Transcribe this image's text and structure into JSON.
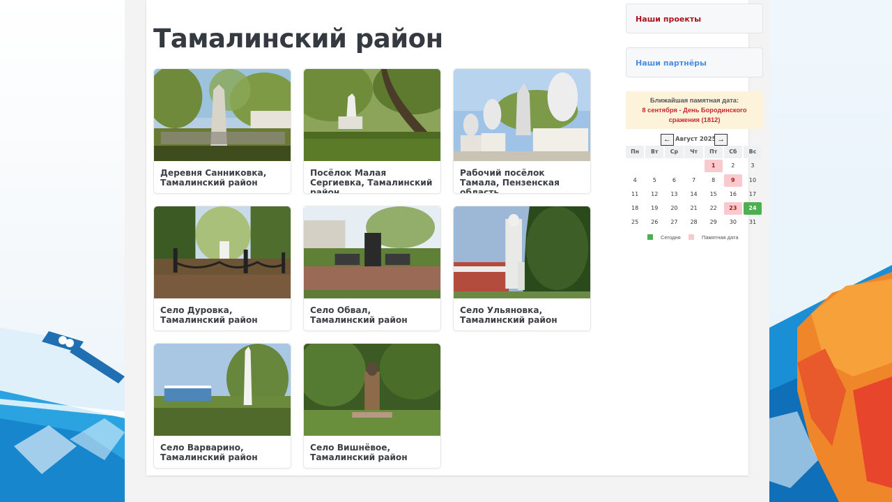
{
  "page": {
    "title": "Тамалинский район"
  },
  "items": [
    {
      "caption": "Деревня Санниковка, Тамалинский район",
      "photo": "monument-obelisk-photo"
    },
    {
      "caption": "Посёлок Малая Сергиевка, Тамалинский район,",
      "photo": "monument-park-photo"
    },
    {
      "caption": "Рабочий посёлок Тамала, Пензенская область",
      "photo": "monument-busts-photo"
    },
    {
      "caption": "Село Дуровка, Тамалинский район",
      "photo": "monument-fenced-photo"
    },
    {
      "caption": "Село Обвал, Тамалинский район",
      "photo": "monument-stele-photo"
    },
    {
      "caption": "Село Ульяновка, Тамалинский район",
      "photo": "monument-statue-photo"
    },
    {
      "caption": "Село Варварино, Тамалинский район",
      "photo": "monument-wall-photo"
    },
    {
      "caption": "Село Вишнёвое, Тамалинский район",
      "photo": "monument-bust-photo"
    }
  ],
  "sidebar": {
    "projects_label": "Наши проекты",
    "partners_label": "Наши партнёры",
    "memo_label": "Ближайшая памятная дата:",
    "memo_date_line1": "8 сентября - День Бородинского",
    "memo_date_line2": "сражения (1812)"
  },
  "calendar": {
    "prev_label": "←",
    "next_label": "→",
    "month_label": "Август 2025",
    "weekdays": [
      "Пн",
      "Вт",
      "Ср",
      "Чт",
      "Пт",
      "Сб",
      "Вс"
    ],
    "weeks": [
      [
        "",
        "",
        "",
        "",
        "1",
        "2",
        "3"
      ],
      [
        "4",
        "5",
        "6",
        "7",
        "8",
        "9",
        "10"
      ],
      [
        "11",
        "12",
        "13",
        "14",
        "15",
        "16",
        "17"
      ],
      [
        "18",
        "19",
        "20",
        "21",
        "22",
        "23",
        "24"
      ],
      [
        "25",
        "26",
        "27",
        "28",
        "29",
        "30",
        "31"
      ]
    ],
    "memorial_days": [
      "1",
      "9",
      "23"
    ],
    "today": "24",
    "legend_today": "Сегодня",
    "legend_memorial": "Памятная дата"
  },
  "colors": {
    "memorial": "#f8c9cd",
    "today": "#4caf50",
    "projects_link": "#b0121a",
    "partners_link": "#4a8fe0"
  }
}
